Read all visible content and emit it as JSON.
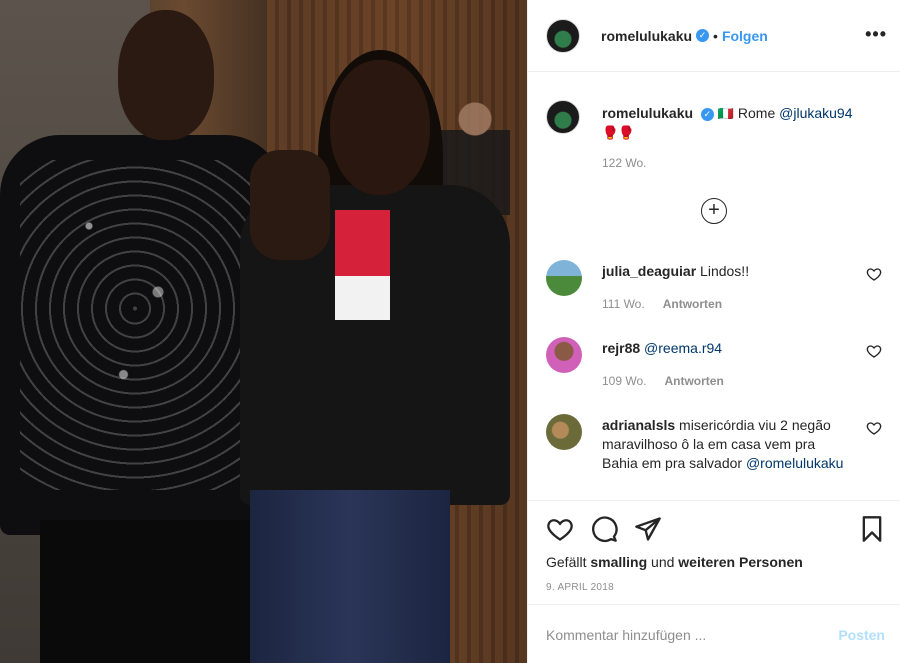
{
  "post": {
    "username": "romelulukaku",
    "follow_label": "Folgen",
    "more_label": "•••"
  },
  "caption": {
    "username": "romelulukaku",
    "flag": "🇮🇹",
    "text": "Rome",
    "mention": "@jlukaku94",
    "emojis": "🥊🥊",
    "time": "122 Wo."
  },
  "load_more_label": "+",
  "comments": [
    {
      "username": "julia_deaguiar",
      "text": "Lindos!!",
      "mention": "",
      "time": "111 Wo.",
      "reply_label": "Antworten"
    },
    {
      "username": "rejr88",
      "text": "",
      "mention": "@reema.r94",
      "time": "109 Wo.",
      "reply_label": "Antworten"
    },
    {
      "username": "adrianalsls",
      "text": "misericórdia viu 2 negão maravilhoso ô la em casa vem pra Bahia em pra salvador",
      "mention": "@romelulukaku",
      "time": "",
      "reply_label": ""
    }
  ],
  "likes": {
    "prefix": "Gefällt",
    "user": "smalling",
    "middle": "und",
    "rest": "weiteren Personen"
  },
  "date": "9. APRIL 2018",
  "comment_box": {
    "placeholder": "Kommentar hinzufügen ...",
    "post_label": "Posten"
  },
  "icons": [
    "heart-icon",
    "comment-icon",
    "share-icon",
    "bookmark-icon",
    "verified-icon",
    "add-icon"
  ],
  "colors": {
    "accent": "#3897f0",
    "post_disabled": "#b2dffc",
    "muted": "#8e8e8e"
  }
}
